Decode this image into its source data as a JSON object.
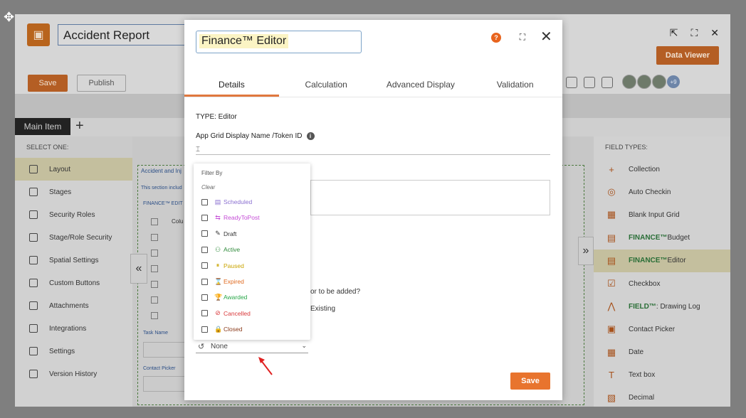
{
  "app": {
    "title": "Accident Report",
    "save_label": "Save",
    "publish_label": "Publish",
    "data_viewer_label": "Data Viewer",
    "avatar_extra": "+9",
    "tab_main": "Main Item",
    "tab_add": "+"
  },
  "left_panel": {
    "header": "SELECT ONE:",
    "items": [
      {
        "label": "Layout",
        "active": true
      },
      {
        "label": "Stages"
      },
      {
        "label": "Security Roles"
      },
      {
        "label": "Stage/Role Security"
      },
      {
        "label": "Spatial Settings"
      },
      {
        "label": "Custom Buttons"
      },
      {
        "label": "Attachments"
      },
      {
        "label": "Integrations"
      },
      {
        "label": "Settings"
      },
      {
        "label": "Version History"
      }
    ]
  },
  "canvas": {
    "section_title": "Accident and Inj",
    "section_note": "This section includ",
    "editor_label": "FINANCE™ EDIT",
    "column_label": "Colu",
    "task_name": "Task Name",
    "contact_picker": "Contact Picker"
  },
  "right_panel": {
    "header": "FIELD TYPES:",
    "items": [
      {
        "label": "Collection",
        "icon": "+"
      },
      {
        "label": "Auto Checkin",
        "icon": "◎"
      },
      {
        "label": "Blank Input Grid",
        "icon": "▦"
      },
      {
        "brand": "FINANCE™",
        "label": " Budget",
        "icon": "▤"
      },
      {
        "brand": "FINANCE™",
        "label": " Editor",
        "icon": "▤",
        "active": true
      },
      {
        "label": "Checkbox",
        "icon": "☑"
      },
      {
        "brand": "FIELD™",
        "label": ": Drawing Log",
        "icon": "⋀"
      },
      {
        "label": "Contact Picker",
        "icon": "▣"
      },
      {
        "label": "Date",
        "icon": "▦"
      },
      {
        "label": "Text box",
        "icon": "T"
      },
      {
        "label": "Decimal",
        "icon": "▧"
      }
    ]
  },
  "modal": {
    "title": "Finance™ Editor",
    "tabs": [
      "Details",
      "Calculation",
      "Advanced Display",
      "Validation"
    ],
    "type_label": "TYPE: Editor",
    "grid_label": "App Grid Display Name /Token ID",
    "grid_value": "",
    "partial_text_1": "or to be added?",
    "partial_text_2": "Existing",
    "select_value": "None",
    "save_label": "Save"
  },
  "dropdown": {
    "filter_by": "Filter By",
    "clear": "Clear",
    "options": [
      {
        "label": "Scheduled",
        "color": "#8a6fd0",
        "icon": "▤"
      },
      {
        "label": "ReadyToPost",
        "color": "#c44bd6",
        "icon": "⇆"
      },
      {
        "label": "Draft",
        "color": "#333333",
        "icon": "✎"
      },
      {
        "label": "Active",
        "color": "#2e8a3a",
        "icon": "⚇"
      },
      {
        "label": "Paused",
        "color": "#c9a400",
        "icon": "⏸"
      },
      {
        "label": "Expired",
        "color": "#e06a1f",
        "icon": "⌛"
      },
      {
        "label": "Awarded",
        "color": "#2aa84a",
        "icon": "🏆"
      },
      {
        "label": "Cancelled",
        "color": "#d9393b",
        "icon": "⊘"
      },
      {
        "label": "Closed",
        "color": "#8a3a1a",
        "icon": "🔒"
      }
    ]
  }
}
